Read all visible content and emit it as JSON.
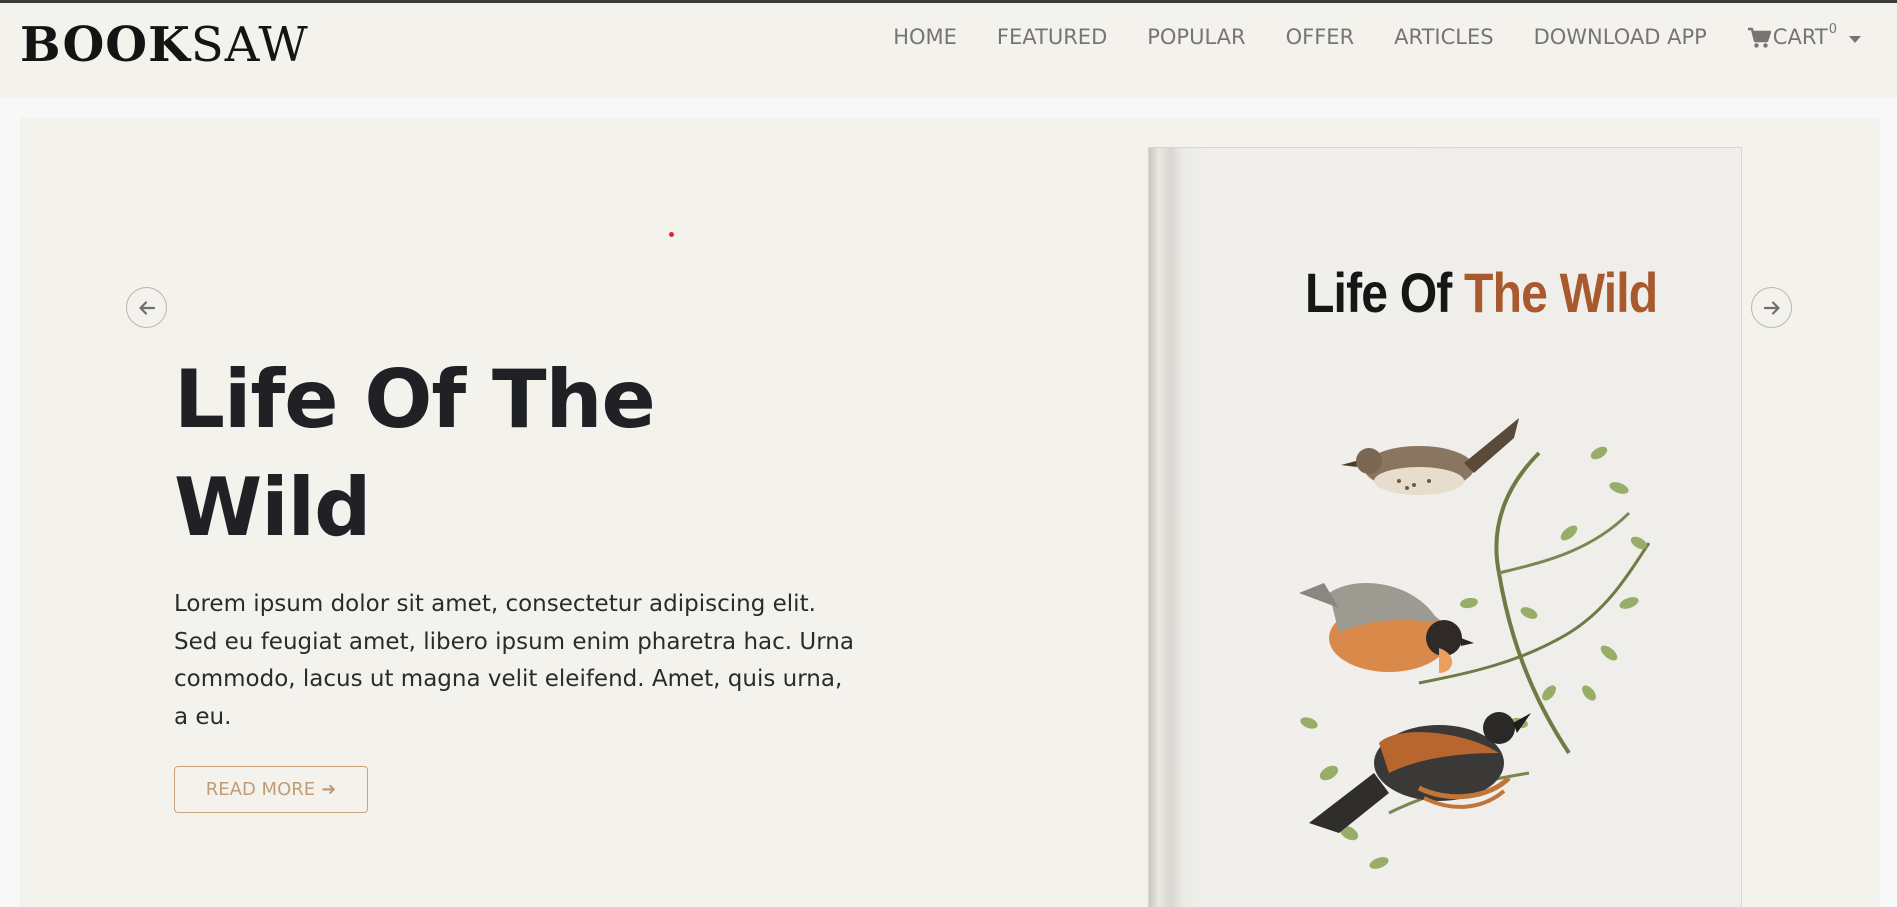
{
  "brand": {
    "part1": "BOOK",
    "part2": "SAW"
  },
  "nav": {
    "items": [
      "HOME",
      "FEATURED",
      "POPULAR",
      "OFFER",
      "ARTICLES",
      "DOWNLOAD APP"
    ],
    "cart_label": "CART",
    "cart_count": "0"
  },
  "hero": {
    "title": "Life Of The Wild",
    "description": "Lorem ipsum dolor sit amet, consectetur adipiscing elit. Sed eu feugiat amet, libero ipsum enim pharetra hac. Urna commodo, lacus ut magna velit eleifend. Amet, quis urna, a eu.",
    "cta": "READ MORE",
    "cta_icon": "arrow-right-icon",
    "prev_icon": "arrow-left-icon",
    "next_icon": "arrow-right-icon"
  },
  "book": {
    "title_part1": "Life Of",
    "title_part2": "The Wild"
  },
  "colors": {
    "header_bg": "#f3f2ec",
    "hero_bg": "#f3f2ed",
    "accent": "#c39c75",
    "book_title_accent": "#a9592e",
    "text_dark": "#202125"
  }
}
